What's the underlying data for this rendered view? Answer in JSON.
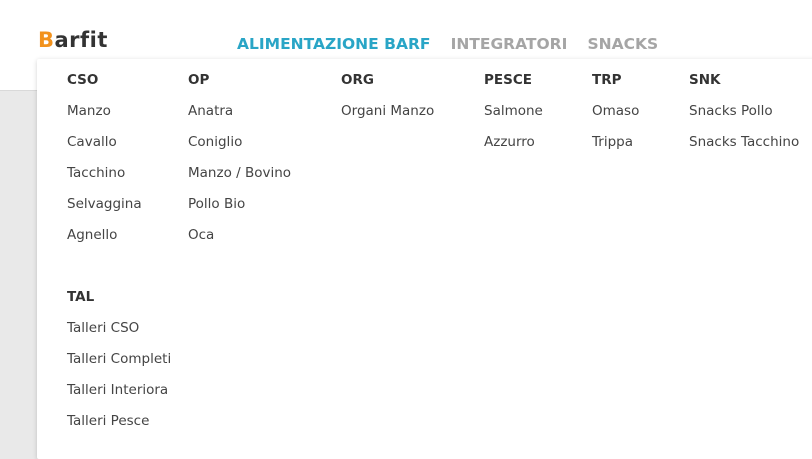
{
  "logo": {
    "first": "B",
    "rest": "arfit"
  },
  "nav": [
    {
      "label": "ALIMENTAZIONE BARF"
    },
    {
      "label": "INTEGRATORI"
    },
    {
      "label": "SNACKS"
    }
  ],
  "menu": {
    "columns": [
      {
        "title": "CSO",
        "items": [
          "Manzo",
          "Cavallo",
          "Tacchino",
          "Selvaggina",
          "Agnello"
        ]
      },
      {
        "title": "OP",
        "items": [
          "Anatra",
          "Coniglio",
          "Manzo / Bovino",
          "Pollo Bio",
          "Oca"
        ]
      },
      {
        "title": "ORG",
        "items": [
          "Organi Manzo"
        ]
      },
      {
        "title": "PESCE",
        "items": [
          "Salmone",
          "Azzurro"
        ]
      },
      {
        "title": "TRP",
        "items": [
          "Omaso",
          "Trippa"
        ]
      },
      {
        "title": "SNK",
        "items": [
          "Snacks Pollo",
          "Snacks Tacchino"
        ]
      },
      {
        "title": "TAL",
        "items": [
          "Talleri CSO",
          "Talleri Completi",
          "Talleri Interiora",
          "Talleri Pesce"
        ]
      }
    ]
  }
}
